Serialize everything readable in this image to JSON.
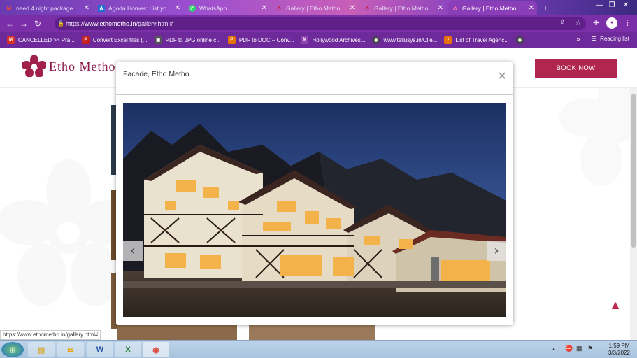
{
  "browser": {
    "tabs": [
      {
        "title": "need 4 night package",
        "icon": "gmail-icon"
      },
      {
        "title": "Agoda Homes: List yo",
        "icon": "agoda-icon"
      },
      {
        "title": "WhatsApp",
        "icon": "whatsapp-icon"
      },
      {
        "title": "Gallery | Etho Metho",
        "icon": "etho-metho-icon"
      },
      {
        "title": "Gallery | Etho Metho",
        "icon": "etho-metho-icon"
      },
      {
        "title": "Gallery | Etho Metho",
        "icon": "etho-metho-icon",
        "active": true
      }
    ],
    "new_tab": "+",
    "url_prefix": "https://",
    "url_host": "www.ethometho.in",
    "url_path": "/gallery.html#",
    "bookmarks": [
      {
        "label": "CANCELLED >> Pra...",
        "icon": "gmail-icon",
        "color": "#d93025",
        "glyph": "M"
      },
      {
        "label": "Convert Excel files (...",
        "icon": "pdf-icon",
        "color": "#c5221f",
        "glyph": "PDF"
      },
      {
        "label": "PDF to JPG online c...",
        "icon": "pdf-jpg-icon",
        "color": "#555555",
        "glyph": "▣"
      },
      {
        "label": "PDF to DOC – Conv...",
        "icon": "pdf-doc-icon",
        "color": "#e37400",
        "glyph": "PDF"
      },
      {
        "label": "Hollywood Archives...",
        "icon": "hollywood-icon",
        "color": "#8e44ad",
        "glyph": "M"
      },
      {
        "label": "www.tellusys.in/Clie...",
        "icon": "globe-icon",
        "color": "#444444",
        "glyph": "◉"
      },
      {
        "label": "List of Travel Agenc...",
        "icon": "travel-icon",
        "color": "#e8710a",
        "glyph": "▪"
      }
    ],
    "reading_list": "Reading list",
    "status_url": "https://www.ethometho.in/gallery.html#"
  },
  "site": {
    "brand": "Etho Metho",
    "book_button": "BOOK NOW",
    "accent_color": "#b0264e"
  },
  "modal": {
    "title": "Facade, Etho Metho",
    "close": "×",
    "prev": "‹",
    "next": "›"
  },
  "taskbar": {
    "time": "1:59 PM",
    "date": "3/3/2022",
    "apps": [
      "start-icon",
      "explorer-icon",
      "outlook-icon",
      "word-icon",
      "excel-icon",
      "chrome-icon"
    ]
  }
}
